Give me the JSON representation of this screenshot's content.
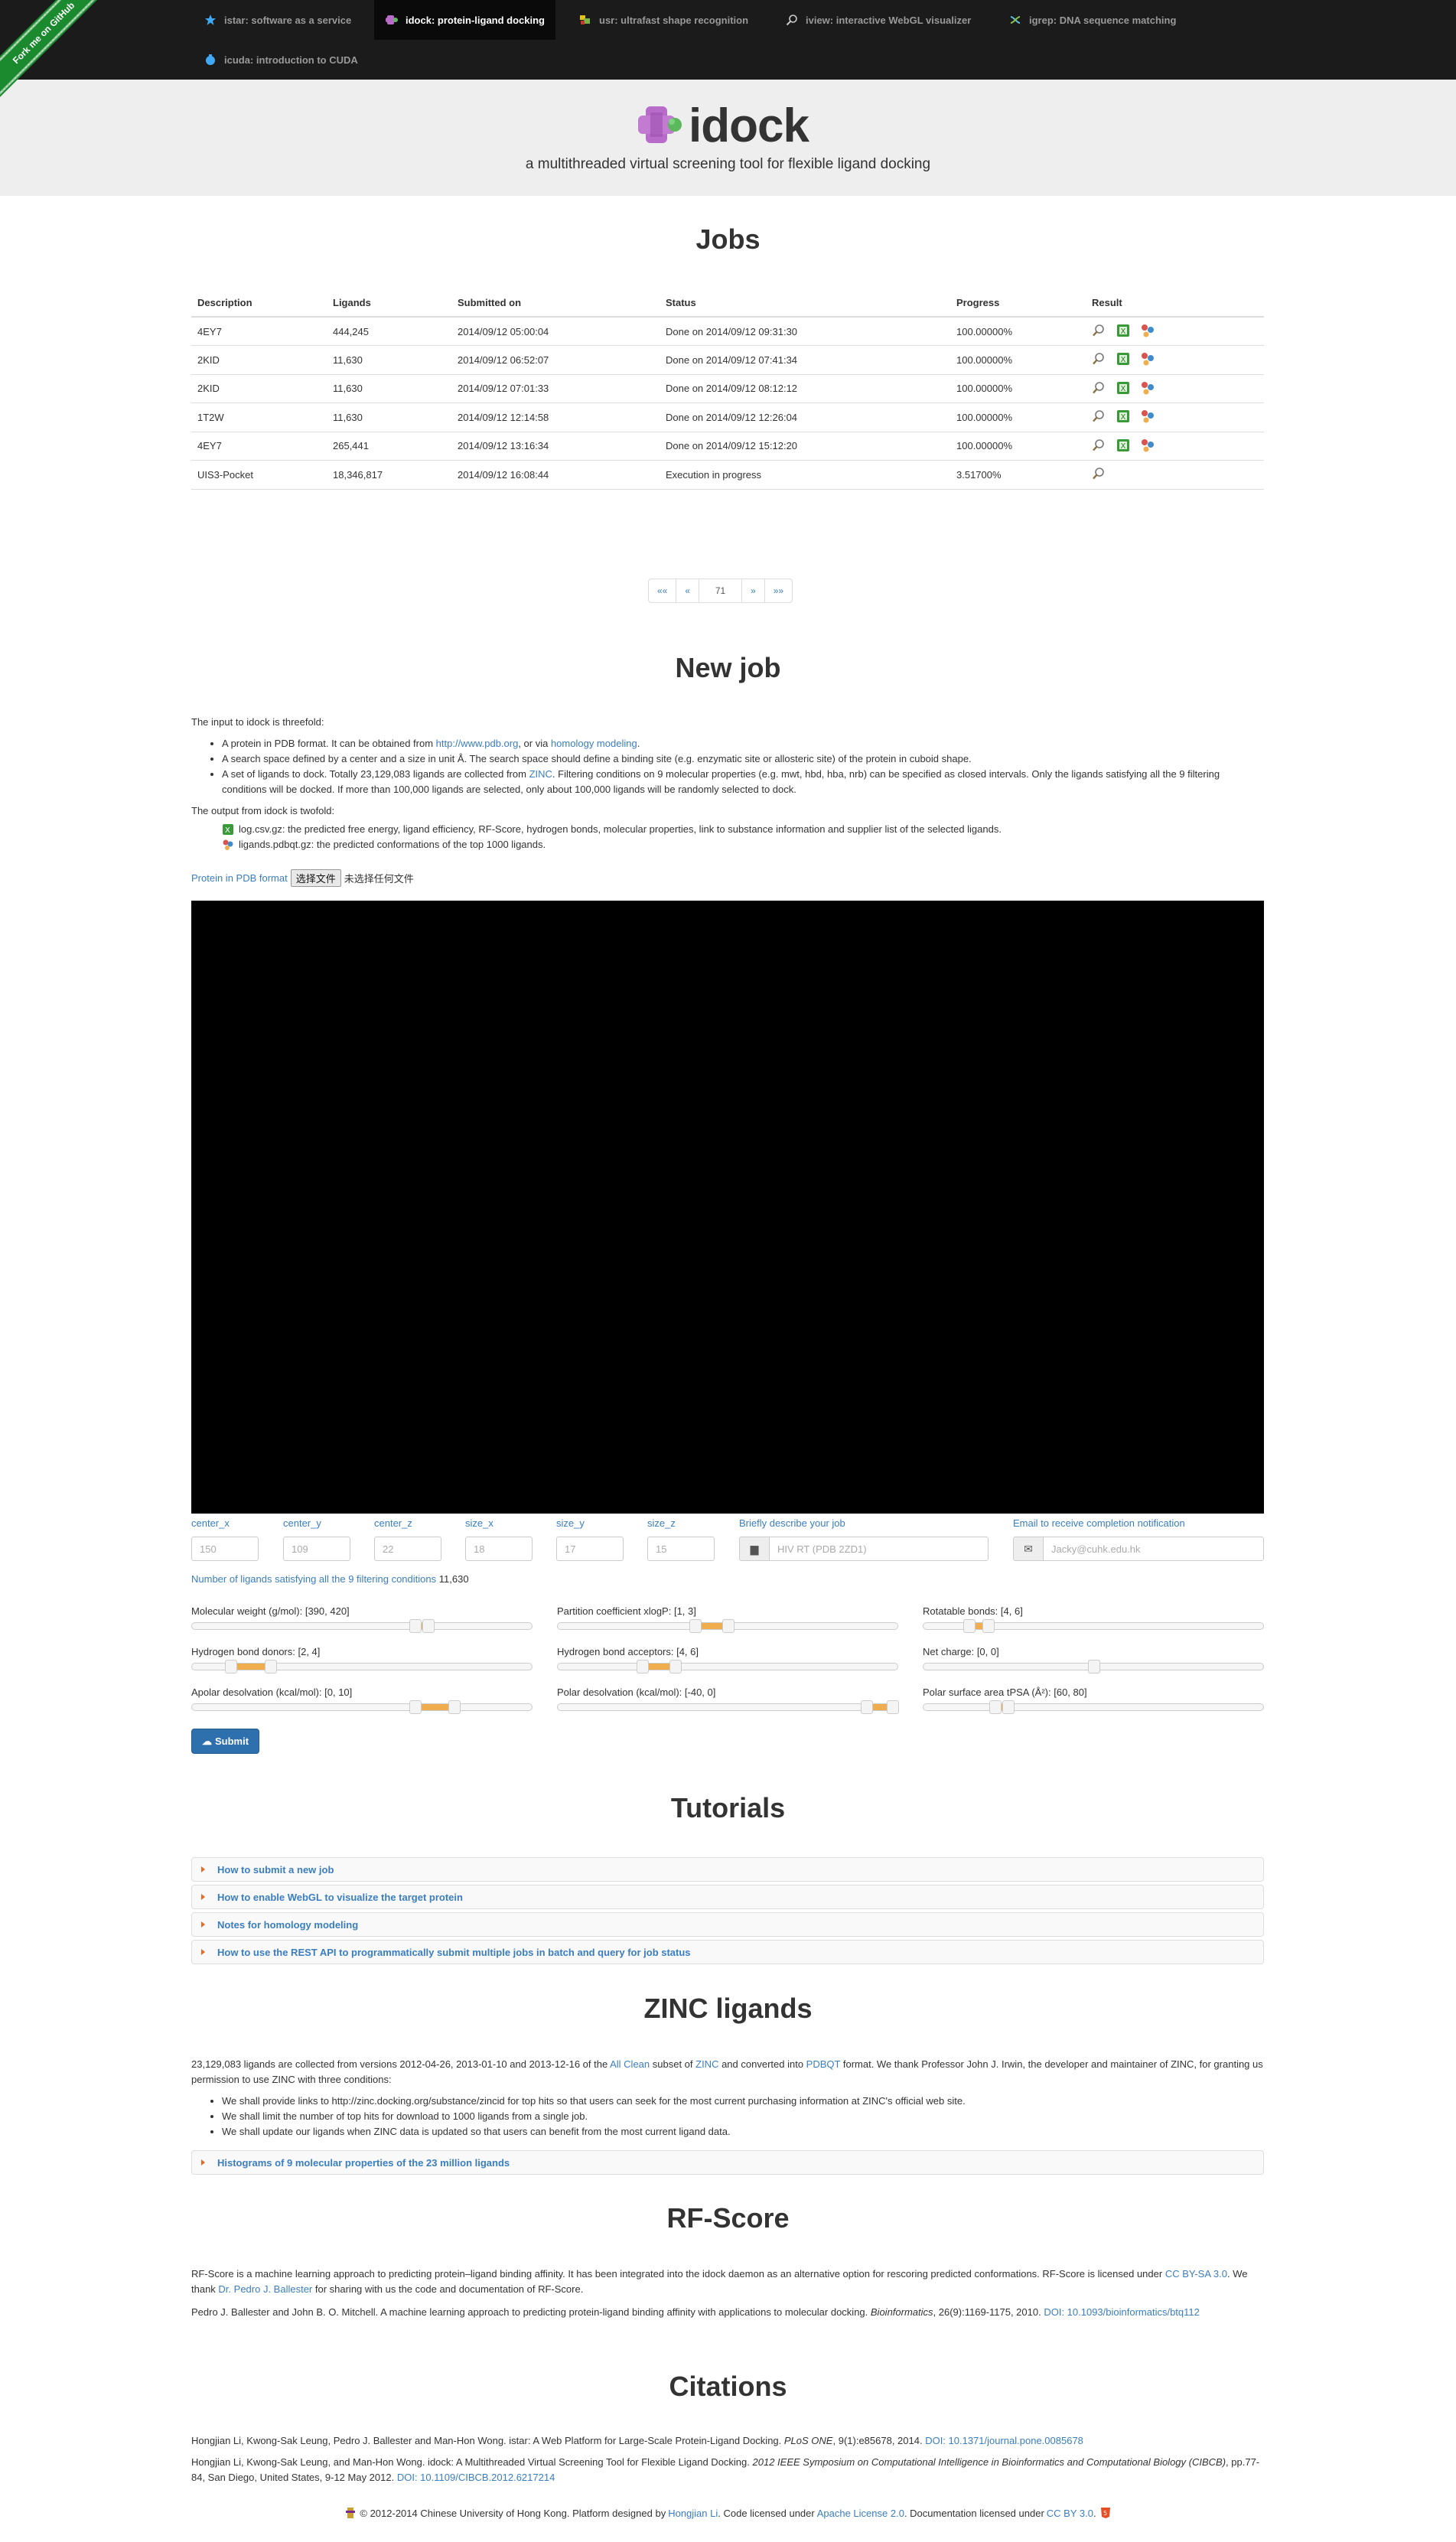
{
  "nav": {
    "ribbon": "Fork me on GitHub",
    "items": [
      {
        "label": "istar: software as a service",
        "icon": "star-icon"
      },
      {
        "label": "idock: protein-ligand docking",
        "icon": "idock-logo-icon"
      },
      {
        "label": "usr: ultrafast shape recognition",
        "icon": "usr-logo-icon"
      },
      {
        "label": "iview: interactive WebGL visualizer",
        "icon": "magnifier-icon"
      },
      {
        "label": "igrep: DNA sequence matching",
        "icon": "dna-icon"
      },
      {
        "label": "icuda: introduction to CUDA",
        "icon": "cuda-icon"
      }
    ]
  },
  "hero": {
    "brand": "idock",
    "tagline": "a multithreaded virtual screening tool for flexible ligand docking"
  },
  "jobs": {
    "title": "Jobs",
    "headers": [
      "Description",
      "Ligands",
      "Submitted on",
      "Status",
      "Progress",
      "Result"
    ],
    "rows": [
      {
        "description": "4EY7",
        "ligands": "444,245",
        "submitted": "2014/09/12 05:00:04",
        "status": "Done on 2014/09/12 09:31:30",
        "progress": "100.00000%",
        "done": true
      },
      {
        "description": "2KID",
        "ligands": "11,630",
        "submitted": "2014/09/12 06:52:07",
        "status": "Done on 2014/09/12 07:41:34",
        "progress": "100.00000%",
        "done": true
      },
      {
        "description": "2KID",
        "ligands": "11,630",
        "submitted": "2014/09/12 07:01:33",
        "status": "Done on 2014/09/12 08:12:12",
        "progress": "100.00000%",
        "done": true
      },
      {
        "description": "1T2W",
        "ligands": "11,630",
        "submitted": "2014/09/12 12:14:58",
        "status": "Done on 2014/09/12 12:26:04",
        "progress": "100.00000%",
        "done": true
      },
      {
        "description": "4EY7",
        "ligands": "265,441",
        "submitted": "2014/09/12 13:16:34",
        "status": "Done on 2014/09/12 15:12:20",
        "progress": "100.00000%",
        "done": true
      },
      {
        "description": "UIS3-Pocket",
        "ligands": "18,346,817",
        "submitted": "2014/09/12 16:08:44",
        "status": "Execution in progress",
        "progress": "3.51700%",
        "done": false
      }
    ],
    "pagination": {
      "first": "««",
      "prev": "«",
      "page": "71",
      "next": "»",
      "last": "»»"
    }
  },
  "newjob": {
    "title": "New job",
    "intro": "The input to idock is threefold:",
    "input_items": [
      {
        "pre": "A protein in PDB format. It can be obtained from ",
        "link1": "http://www.pdb.org",
        "mid": ", or via ",
        "link2": "homology modeling",
        "post": "."
      },
      {
        "text": "A search space defined by a center and a size in unit Å. The search space should define a binding site (e.g. enzymatic site or allosteric site) of the protein in cuboid shape."
      },
      {
        "pre": "A set of ligands to dock. Totally 23,129,083 ligands are collected from ",
        "link1": "ZINC",
        "post": ". Filtering conditions on 9 molecular properties (e.g. mwt, hbd, hba, nrb) can be specified as closed intervals. Only the ligands satisfying all the 9 filtering conditions will be docked. If more than 100,000 ligands are selected, only about 100,000 ligands will be randomly selected to dock."
      }
    ],
    "output_intro": "The output from idock is twofold:",
    "output_items": [
      "log.csv.gz: the predicted free energy, ligand efficiency, RF-Score, hydrogen bonds, molecular properties, link to substance information and supplier list of the selected ligands.",
      "ligands.pdbqt.gz: the predicted conformations of the top 1000 ligands."
    ],
    "file_label": "Protein in PDB format",
    "file_button": "选择文件",
    "file_status": "未选择任何文件",
    "fields": {
      "center_x": {
        "label": "center_x",
        "placeholder": "150"
      },
      "center_y": {
        "label": "center_y",
        "placeholder": "109"
      },
      "center_z": {
        "label": "center_z",
        "placeholder": "22"
      },
      "size_x": {
        "label": "size_x",
        "placeholder": "18"
      },
      "size_y": {
        "label": "size_y",
        "placeholder": "17"
      },
      "size_z": {
        "label": "size_z",
        "placeholder": "15"
      },
      "description": {
        "label": "Briefly describe your job",
        "placeholder": "HIV RT (PDB 2ZD1)"
      },
      "email": {
        "label": "Email to receive completion notification",
        "placeholder": "Jacky@cuhk.edu.hk"
      }
    },
    "count_label": "Number of ligands satisfying all the 9 filtering conditions",
    "count_value": "11,630",
    "sliders": [
      {
        "label": "Molecular weight (g/mol): [390, 420]",
        "lo": 0.66,
        "hi": 0.7
      },
      {
        "label": "Partition coefficient xlogP: [1, 3]",
        "lo": 0.4,
        "hi": 0.5
      },
      {
        "label": "Rotatable bonds: [4, 6]",
        "lo": 0.12,
        "hi": 0.18
      },
      {
        "label": "Hydrogen bond donors: [2, 4]",
        "lo": 0.1,
        "hi": 0.22
      },
      {
        "label": "Hydrogen bond acceptors: [4, 6]",
        "lo": 0.24,
        "hi": 0.34
      },
      {
        "label": "Net charge: [0, 0]",
        "lo": 0.5,
        "hi": 0.5
      },
      {
        "label": "Apolar desolvation (kcal/mol): [0, 10]",
        "lo": 0.66,
        "hi": 0.78
      },
      {
        "label": "Polar desolvation (kcal/mol): [-40, 0]",
        "lo": 0.92,
        "hi": 1.0
      },
      {
        "label": "Polar surface area tPSA (Å²): [60, 80]",
        "lo": 0.2,
        "hi": 0.24
      }
    ],
    "submit": "Submit"
  },
  "tutorials": {
    "title": "Tutorials",
    "items": [
      "How to submit a new job",
      "How to enable WebGL to visualize the target protein",
      "Notes for homology modeling",
      "How to use the REST API to programmatically submit multiple jobs in batch and query for job status"
    ]
  },
  "zinc": {
    "title": "ZINC ligands",
    "p1_pre": "23,129,083 ligands are collected from versions 2012-04-26, 2013-01-10 and 2013-12-16 of the ",
    "p1_link1": "All Clean",
    "p1_mid1": " subset of ",
    "p1_link2": "ZINC",
    "p1_mid2": " and converted into ",
    "p1_link3": "PDBQT",
    "p1_post": " format. We thank Professor John J. Irwin, the developer and maintainer of ZINC, for granting us permission to use ZINC with three conditions:",
    "conditions": [
      "We shall provide links to http://zinc.docking.org/substance/zincid for top hits so that users can seek for the most current purchasing information at ZINC's official web site.",
      "We shall limit the number of top hits for download to 1000 ligands from a single job.",
      "We shall update our ligands when ZINC data is updated so that users can benefit from the most current ligand data."
    ],
    "accordion": "Histograms of 9 molecular properties of the 23 million ligands"
  },
  "rfscore": {
    "title": "RF-Score",
    "p1_pre": "RF-Score is a machine learning approach to predicting protein–ligand binding affinity. It has been integrated into the idock daemon as an alternative option for rescoring predicted conformations. RF-Score is licensed under ",
    "p1_link1": "CC BY-SA 3.0",
    "p1_mid": ". We thank ",
    "p1_link2": "Dr. Pedro J. Ballester",
    "p1_post": " for sharing with us the code and documentation of RF-Score.",
    "ref_pre": "Pedro J. Ballester and John B. O. Mitchell. A machine learning approach to predicting protein-ligand binding affinity with applications to molecular docking. ",
    "ref_journal": "Bioinformatics",
    "ref_post": ", 26(9):1169-1175, 2010. ",
    "ref_doi": "DOI: 10.1093/bioinformatics/btq112"
  },
  "citations": {
    "title": "Citations",
    "c1_pre": "Hongjian Li, Kwong-Sak Leung, Pedro J. Ballester and Man-Hon Wong. istar: A Web Platform for Large-Scale Protein-Ligand Docking. ",
    "c1_journal": "PLoS ONE",
    "c1_post": ", 9(1):e85678, 2014. ",
    "c1_doi": "DOI: 10.1371/journal.pone.0085678",
    "c2_pre": "Hongjian Li, Kwong-Sak Leung, and Man-Hon Wong. idock: A Multithreaded Virtual Screening Tool for Flexible Ligand Docking. ",
    "c2_journal": "2012 IEEE Symposium on Computational Intelligence in Bioinformatics and Computational Biology (CIBCB)",
    "c2_post": ", pp.77-84, San Diego, United States, 9-12 May 2012. ",
    "c2_doi": "DOI: 10.1109/CIBCB.2012.6217214"
  },
  "footer": {
    "pre": "© 2012-2014 Chinese University of Hong Kong. Platform designed by ",
    "designer": "Hongjian Li",
    "mid1": ". Code licensed under ",
    "code_license": "Apache License 2.0",
    "mid2": ". Documentation licensed under ",
    "doc_license": "CC BY 3.0",
    "post": "."
  },
  "colors": {
    "navbar": "#1b1b1b",
    "hero": "#eeeeee",
    "link": "#3a7ec0",
    "slider_range": "#f0ad4e",
    "submit": "#2e6fad",
    "ribbon": "#1b8a2e"
  }
}
